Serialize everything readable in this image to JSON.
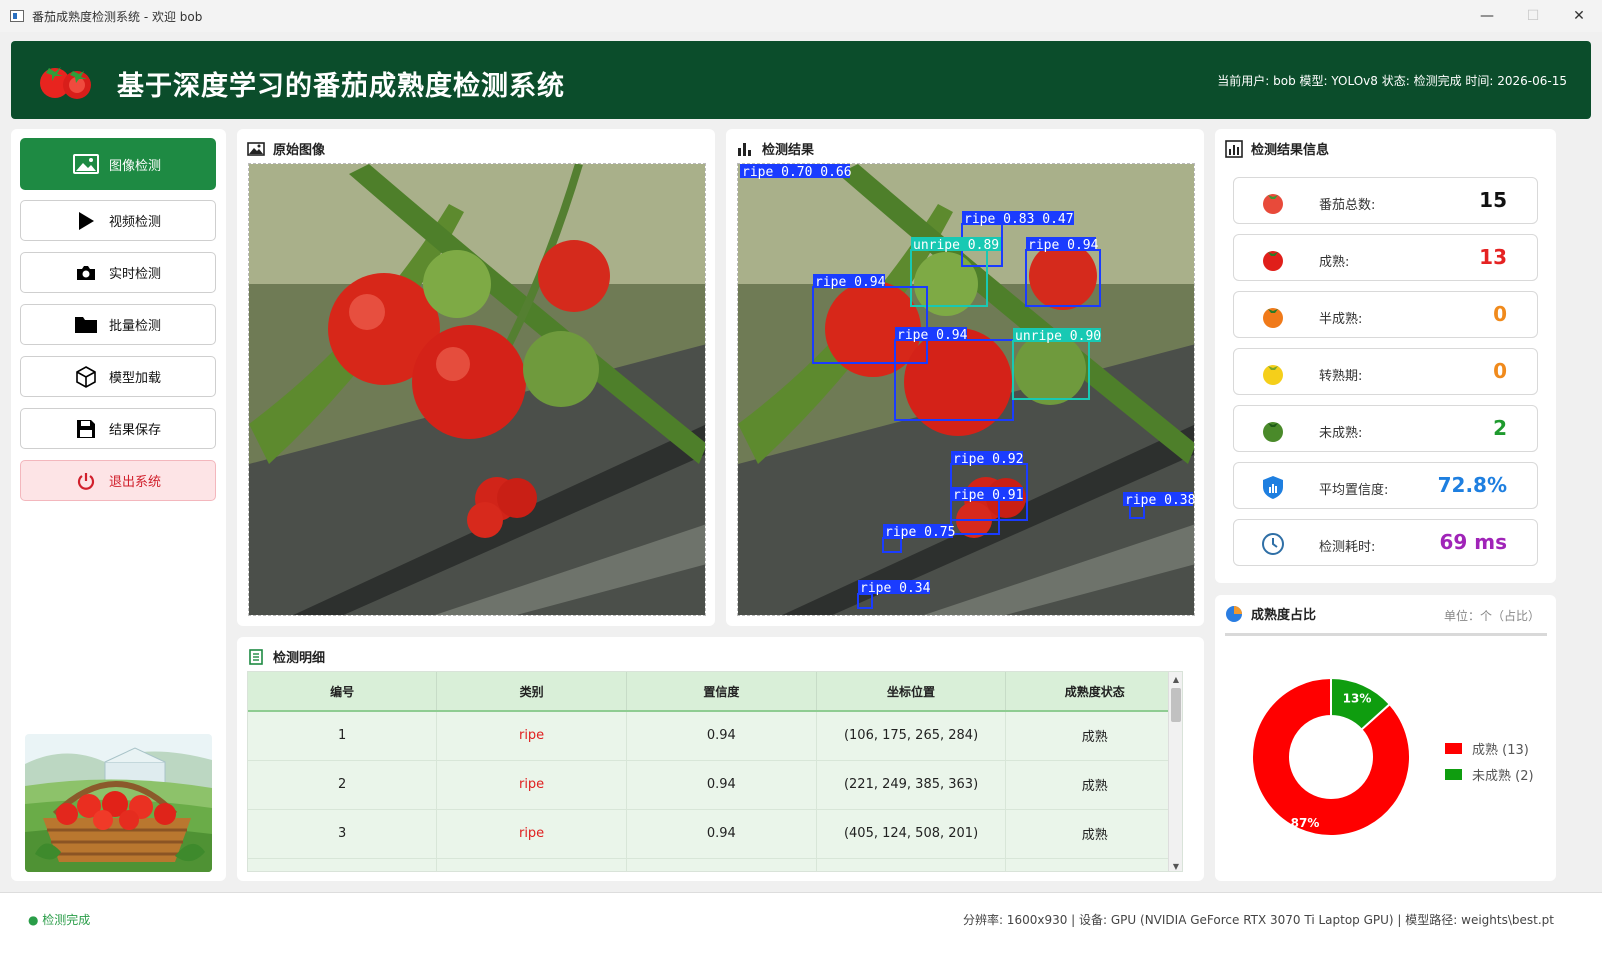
{
  "window": {
    "title": "番茄成熟度检测系统 - 欢迎 bob",
    "minimize": "—",
    "maximize": "☐",
    "close": "✕"
  },
  "header": {
    "title": "基于深度学习的番茄成熟度检测系统",
    "status_line": "当前用户: bob  模型: YOLOv8  状态: 检测完成  时间: 2026-06-15"
  },
  "sidebar": {
    "items": [
      {
        "label": "图像检测",
        "icon": "image-icon"
      },
      {
        "label": "视频检测",
        "icon": "play-icon"
      },
      {
        "label": "实时检测",
        "icon": "camera-icon"
      },
      {
        "label": "批量检测",
        "icon": "folder-icon"
      },
      {
        "label": "模型加载",
        "icon": "cube-icon"
      },
      {
        "label": "结果保存",
        "icon": "save-icon"
      },
      {
        "label": "退出系统",
        "icon": "power-icon"
      }
    ]
  },
  "original_panel": {
    "title": "原始图像"
  },
  "result_panel": {
    "title": "检测结果",
    "boxes": [
      {
        "label": "ripe 0.70 0.66",
        "color": "#1a3cff"
      },
      {
        "label": "ripe 0.83 0.47",
        "color": "#1a3cff"
      },
      {
        "label": "unripe 0.89",
        "color": "#18c9b3"
      },
      {
        "label": "ripe 0.94",
        "color": "#1a3cff"
      },
      {
        "label": "ripe 0.94",
        "color": "#1a3cff"
      },
      {
        "label": "ripe 0.94",
        "color": "#1a3cff"
      },
      {
        "label": "unripe 0.90",
        "color": "#18c9b3"
      },
      {
        "label": "ripe 0.92",
        "color": "#1a3cff"
      },
      {
        "label": "ripe 0.91",
        "color": "#1a3cff"
      },
      {
        "label": "ripe 0.38",
        "color": "#1a3cff"
      },
      {
        "label": "ripe 0.75",
        "color": "#1a3cff"
      },
      {
        "label": "ripe 0.34",
        "color": "#1a3cff"
      }
    ]
  },
  "info_panel": {
    "title": "检测结果信息",
    "stats": [
      {
        "label": "番茄总数:",
        "value": "15",
        "color": "#111111",
        "icon": "tomato-icon"
      },
      {
        "label": "成熟:",
        "value": "13",
        "color": "#e52222",
        "icon": "ripe-tomato-icon"
      },
      {
        "label": "半成熟:",
        "value": "0",
        "color": "#f08a1c",
        "icon": "half-ripe-tomato-icon"
      },
      {
        "label": "转熟期:",
        "value": "0",
        "color": "#f08a1c",
        "icon": "turning-tomato-icon"
      },
      {
        "label": "未成熟:",
        "value": "2",
        "color": "#1f9a2e",
        "icon": "unripe-tomato-icon"
      },
      {
        "label": "平均置信度:",
        "value": "72.8%",
        "color": "#1e7fe0",
        "icon": "shield-icon"
      },
      {
        "label": "检测耗时:",
        "value": "69 ms",
        "color": "#a024b8",
        "icon": "clock-icon"
      }
    ]
  },
  "detail_panel": {
    "title": "检测明细",
    "columns": [
      "编号",
      "类别",
      "置信度",
      "坐标位置",
      "成熟度状态"
    ],
    "rows": [
      [
        "1",
        "ripe",
        "0.94",
        "(106, 175, 265, 284)",
        "成熟"
      ],
      [
        "2",
        "ripe",
        "0.94",
        "(221, 249, 385, 363)",
        "成熟"
      ],
      [
        "3",
        "ripe",
        "0.94",
        "(405, 124, 508, 201)",
        "成熟"
      ]
    ]
  },
  "pie_panel": {
    "title": "成熟度占比",
    "unit": "单位：个（占比）",
    "chart_data": {
      "type": "pie",
      "categories": [
        "成熟",
        "未成熟"
      ],
      "values": [
        13,
        2
      ],
      "legend": [
        "成熟 (13)",
        "未成熟 (2)"
      ],
      "slice_labels": [
        "87%",
        "13%"
      ],
      "colors": [
        "#ff0000",
        "#0f9d0f"
      ],
      "legend_position": "right"
    }
  },
  "statusbar": {
    "left": "● 检测完成",
    "right": "分辨率: 1600x930  |  设备: GPU (NVIDIA GeForce RTX 3070 Ti Laptop GPU)  |  模型路径: weights\\best.pt"
  }
}
